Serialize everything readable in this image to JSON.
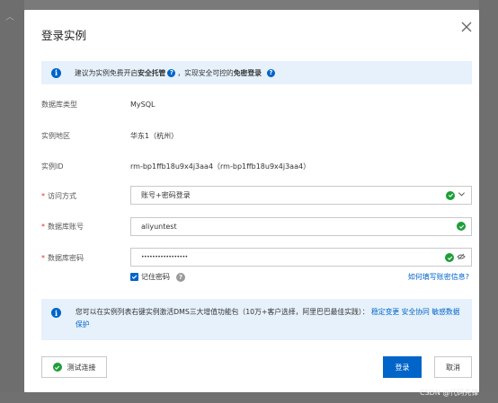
{
  "dialog": {
    "title": "登录实例"
  },
  "info_bar": {
    "text_prefix": "建议为实例免费开启",
    "hosting_label": "安全托管",
    "text_middle": "，实现安全可控的",
    "free_login_label": "免密登录"
  },
  "fields": {
    "db_type": {
      "label": "数据库类型",
      "value": "MySQL"
    },
    "region": {
      "label": "实例地区",
      "value": "华东1（杭州）"
    },
    "instance_id": {
      "label": "实例ID",
      "value": "rm-bp1ffb18u9x4j3aa4（rm-bp1ffb18u9x4j3aa4）"
    },
    "access_method": {
      "label": "访问方式",
      "value": "账号+密码登录"
    },
    "db_account": {
      "label": "数据库账号",
      "value": "aliyuntest"
    },
    "db_password": {
      "label": "数据库密码",
      "value": "•••••••••••••••••"
    }
  },
  "required_mark": "*",
  "remember": {
    "label": "记住密码",
    "checked": true
  },
  "howto_link": "如何填写账密信息?",
  "notice": {
    "text": "您可以在实例列表右键实例激活DMS三大增值功能包（10万+客户选择，阿里巴巴最佳实践）：",
    "link1": "稳定变更",
    "link2": "安全协同",
    "link3": "敏感数据保护"
  },
  "buttons": {
    "test": "测试连接",
    "login": "登录",
    "cancel": "取消"
  },
  "watermark": "CSDN @代码先锋",
  "colors": {
    "primary": "#0064c8",
    "success": "#1e9e3a",
    "info_bg": "#e6f1fb",
    "required": "#e0301e"
  }
}
